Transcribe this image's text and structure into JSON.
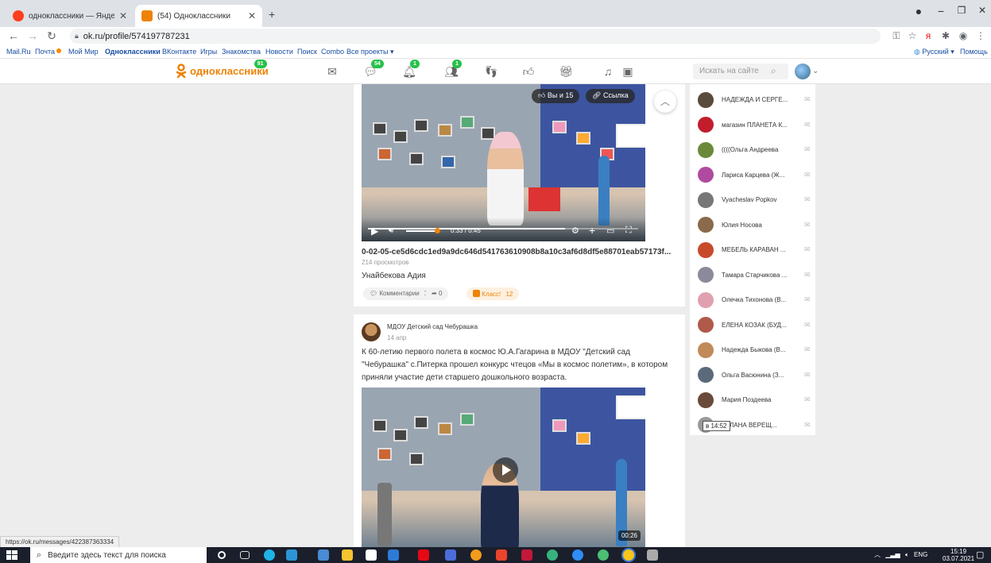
{
  "browser": {
    "tabs": [
      {
        "title": "одноклассники — Яндекс: наш",
        "active": false,
        "favicon_color": "#fc3f1d"
      },
      {
        "title": "(54) Одноклассники",
        "active": true,
        "favicon_color": "#ee8208"
      }
    ],
    "new_tab": "+",
    "url": "ok.ru/profile/574197787231",
    "window_controls": {
      "minimize": "−",
      "maximize": "❐",
      "close": "✕"
    }
  },
  "bookmarks": [
    {
      "label": "Mail.Ru",
      "bold": false
    },
    {
      "label": "Почта",
      "bold": false
    },
    {
      "label": "Мой Мир",
      "bold": false
    },
    {
      "label": "Одноклассники",
      "bold": true
    },
    {
      "label": "ВКонтакте",
      "bold": false
    },
    {
      "label": "Игры",
      "bold": false
    },
    {
      "label": "Знакомства",
      "bold": false
    },
    {
      "label": "Новости",
      "bold": false
    },
    {
      "label": "Поиск",
      "bold": false
    },
    {
      "label": "Combo",
      "bold": false
    },
    {
      "label": "Все проекты ▾",
      "bold": false
    }
  ],
  "bookmarks_right": {
    "language": "Русский ▾",
    "help": "Помощь"
  },
  "ok_header": {
    "logo": "одноклассники",
    "logo_badge": "91",
    "badges": {
      "messages": "54",
      "notifications": "1",
      "friends": "1"
    },
    "search_placeholder": "Искать на сайте"
  },
  "post1": {
    "likes_pill": "Вы и 15",
    "link_pill": "Ссылка",
    "time": "0:33 / 0:45",
    "progress": 0.73,
    "title": "0-02-05-ce5d6cdc1ed9a9dc646d541763610908b8a10c3af6d8df5e88701eab57173f...",
    "views": "214 просмотров",
    "author_text": "Унайбекова Адия",
    "comments_label": "Комментарии",
    "comments_count": "2",
    "shares_count": "0",
    "likes_label": "Класс!",
    "likes_count": "12"
  },
  "post2": {
    "group": "МДОУ Детский сад Чебурашка",
    "date": "14 апр",
    "text": "К 60-летию  первого полета в космос Ю.А.Гагарина в МДОУ \"Детский сад \"Чебурашка\" с.Питерка прошел конкурс чтецов  «Мы в космос полетим», в котором приняли участие дети старшего дошкольного возраста.",
    "duration": "00:26"
  },
  "friends": [
    {
      "name": "НАДЕЖДА И СЕРГЕ...",
      "color": "#5a4a3a"
    },
    {
      "name": "магазин ПЛАНЕТА К...",
      "color": "#c21d2d"
    },
    {
      "name": "((((Ольга Андреева",
      "color": "#6a8a3a"
    },
    {
      "name": "Лариса Карцева (Ж...",
      "color": "#b04aa0"
    },
    {
      "name": "Vyacheslav Popkov",
      "color": "#777777"
    },
    {
      "name": "Юлия Носова",
      "color": "#8a6a4a"
    },
    {
      "name": "МЕБЕЛЬ КАРАВАН ...",
      "color": "#c84a2a"
    },
    {
      "name": "Тамара Старчикова ...",
      "color": "#8a8a9a"
    },
    {
      "name": "Олечка Тихонова (В...",
      "color": "#e0a0b0"
    },
    {
      "name": "ЕЛЕНА КОЗАК (БУД...",
      "color": "#b05a4a"
    },
    {
      "name": "Надежда Быкова (В...",
      "color": "#c08a5a"
    },
    {
      "name": "Ольга Васюнина (З...",
      "color": "#5a6a7a"
    },
    {
      "name": "Мария Поздеева",
      "color": "#6a4a3a"
    },
    {
      "name": "ЕТЛАНА ВЕРЕЩ...",
      "color": "#999999"
    }
  ],
  "tooltip": "в 14:52",
  "status_url": "https://ok.ru/messages/422387363334",
  "taskbar": {
    "search_placeholder": "Введите здесь текст для поиска",
    "tray": "ENG",
    "time": "15:19",
    "date": "03.07.2021"
  }
}
